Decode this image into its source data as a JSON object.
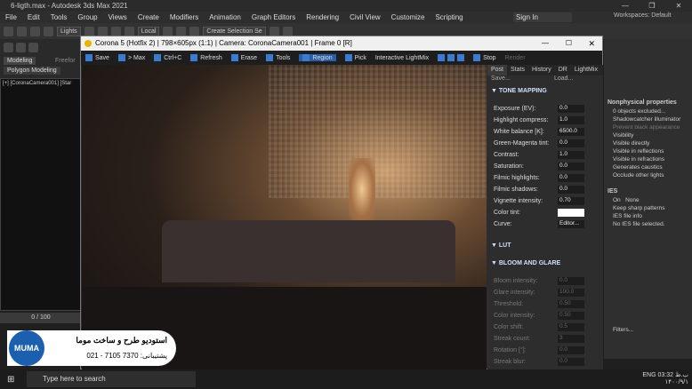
{
  "app": {
    "title": "6-ligth.max - Autodesk 3ds Max 2021"
  },
  "menu": [
    "File",
    "Edit",
    "Tools",
    "Group",
    "Views",
    "Create",
    "Modifiers",
    "Animation",
    "Graph Editors",
    "Rendering",
    "Civil View",
    "Customize",
    "Scripting"
  ],
  "signin": "Sign In",
  "workspaces": "Workspaces: Default",
  "toolbar": {
    "lights": "Lights",
    "local": "Local",
    "create_sel": "Create Selection Se"
  },
  "left_tabs": {
    "modeling": "Modeling",
    "freeform": "Freefor",
    "poly": "Polygon Modeling"
  },
  "viewport_label": "[+] [CoronaCamera001] [Star",
  "timeslider": "0 / 100",
  "frame_window": {
    "title": "Corona 5 (Hotfix 2) | 798×605px (1:1) | Camera: CoronaCamera001 | Frame 0 [R]",
    "buttons": {
      "save": "Save",
      "max": "> Max",
      "ctrlc": "Ctrl+C",
      "refresh": "Refresh",
      "erase": "Erase",
      "tools": "Tools",
      "region": "Region",
      "pick": "Pick",
      "ilm": "Interactive LightMix",
      "stop": "Stop",
      "render": "Render"
    },
    "panel_tabs": [
      "Post",
      "Stats",
      "History",
      "DR",
      "LightMix"
    ],
    "panel_top": {
      "save": "Save...",
      "load": "Load..."
    },
    "sections": {
      "tone": "TONE MAPPING",
      "lut": "LUT",
      "bloom": "BLOOM AND GLARE"
    },
    "tone_rows": [
      {
        "label": "Exposure (EV):",
        "value": "0.0"
      },
      {
        "label": "Highlight compress:",
        "value": "1.0"
      },
      {
        "label": "White balance [K]:",
        "value": "6500.0"
      },
      {
        "label": "Green-Magenta tint:",
        "value": "0.0"
      },
      {
        "label": "Contrast:",
        "value": "1.0"
      },
      {
        "label": "Saturation:",
        "value": "0.0"
      },
      {
        "label": "Filmic highlights:",
        "value": "0.0"
      },
      {
        "label": "Filmic shadows:",
        "value": "0.0"
      },
      {
        "label": "Vignette intensity:",
        "value": "0.70"
      },
      {
        "label": "Color tint:",
        "value": ""
      },
      {
        "label": "Curve:",
        "value": "Editor..."
      }
    ],
    "bloom_rows": [
      {
        "label": "Bloom intensity:",
        "value": "0.0"
      },
      {
        "label": "Glare intensity:",
        "value": "100.0"
      },
      {
        "label": "Threshold:",
        "value": "0.50"
      },
      {
        "label": "Color intensity:",
        "value": "0.50"
      },
      {
        "label": "Color shift:",
        "value": "0.5"
      },
      {
        "label": "Streak count:",
        "value": "3"
      },
      {
        "label": "Rotation [°]:",
        "value": "0.0"
      },
      {
        "label": "Streak blur:",
        "value": "0.0"
      }
    ]
  },
  "right_panel": {
    "header": "Nonphysical properties",
    "rows": [
      "0 objects excluded...",
      "Shadowcatcher illuminator",
      "Prevent black appearance",
      "Visibility",
      "Visible directly",
      "Visible in reflections",
      "Visible in refractions",
      "Generates caustics",
      "Occlude other lights"
    ],
    "ies": "IES",
    "ies_on": "On",
    "ies_none": "None",
    "keep_sharp": "Keep sharp patterns",
    "ies_info": "IES file info",
    "ies_none_sel": "No IES file selected.",
    "filters": "Filters..."
  },
  "logo": {
    "line1": "استودیو طرح و ساخت موما",
    "line2": "پشتیبانی: 7370 7105 - 021"
  },
  "taskbar": {
    "search": "Type here to search",
    "time": "03:32 ب.ظ",
    "date": "۱۴۰۰/۹/۱",
    "lang": "ENG"
  }
}
